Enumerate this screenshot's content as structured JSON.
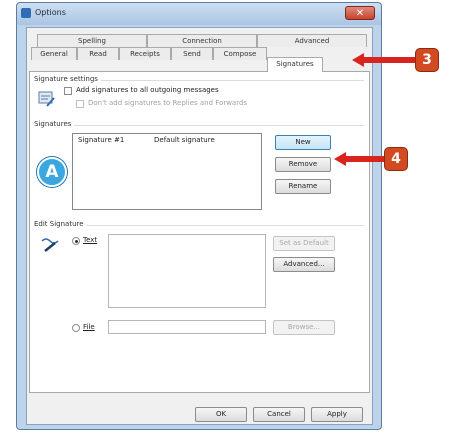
{
  "window": {
    "title": "Options",
    "close_glyph": "✕"
  },
  "tabs": {
    "row1": [
      "Spelling",
      "Connection",
      "Advanced"
    ],
    "row2": [
      "General",
      "Read",
      "Receipts",
      "Send",
      "Compose",
      "Signatures"
    ],
    "active": "Signatures"
  },
  "signature_settings": {
    "group_label": "Signature settings",
    "add_to_outgoing_label": "Add signatures to all outgoing messages",
    "dont_add_replies_label": "Don't add signatures to Replies and Forwards"
  },
  "signatures": {
    "group_label": "Signatures",
    "list": [
      {
        "name": "Signature #1",
        "status": "Default signature"
      }
    ],
    "new_label": "New",
    "remove_label": "Remove",
    "rename_label": "Rename"
  },
  "edit_signature": {
    "group_label": "Edit Signature",
    "text_label": "Text",
    "file_label": "File",
    "set_default_label": "Set as Default",
    "advanced_label": "Advanced...",
    "browse_label": "Browse..."
  },
  "footer": {
    "ok_label": "OK",
    "cancel_label": "Cancel",
    "apply_label": "Apply"
  },
  "callouts": {
    "step3": "3",
    "step4": "4",
    "a": "A"
  },
  "colors": {
    "callout_orange": "#d24a22",
    "callout_blue": "#3aa7df",
    "arrow_red": "#d8231e"
  }
}
